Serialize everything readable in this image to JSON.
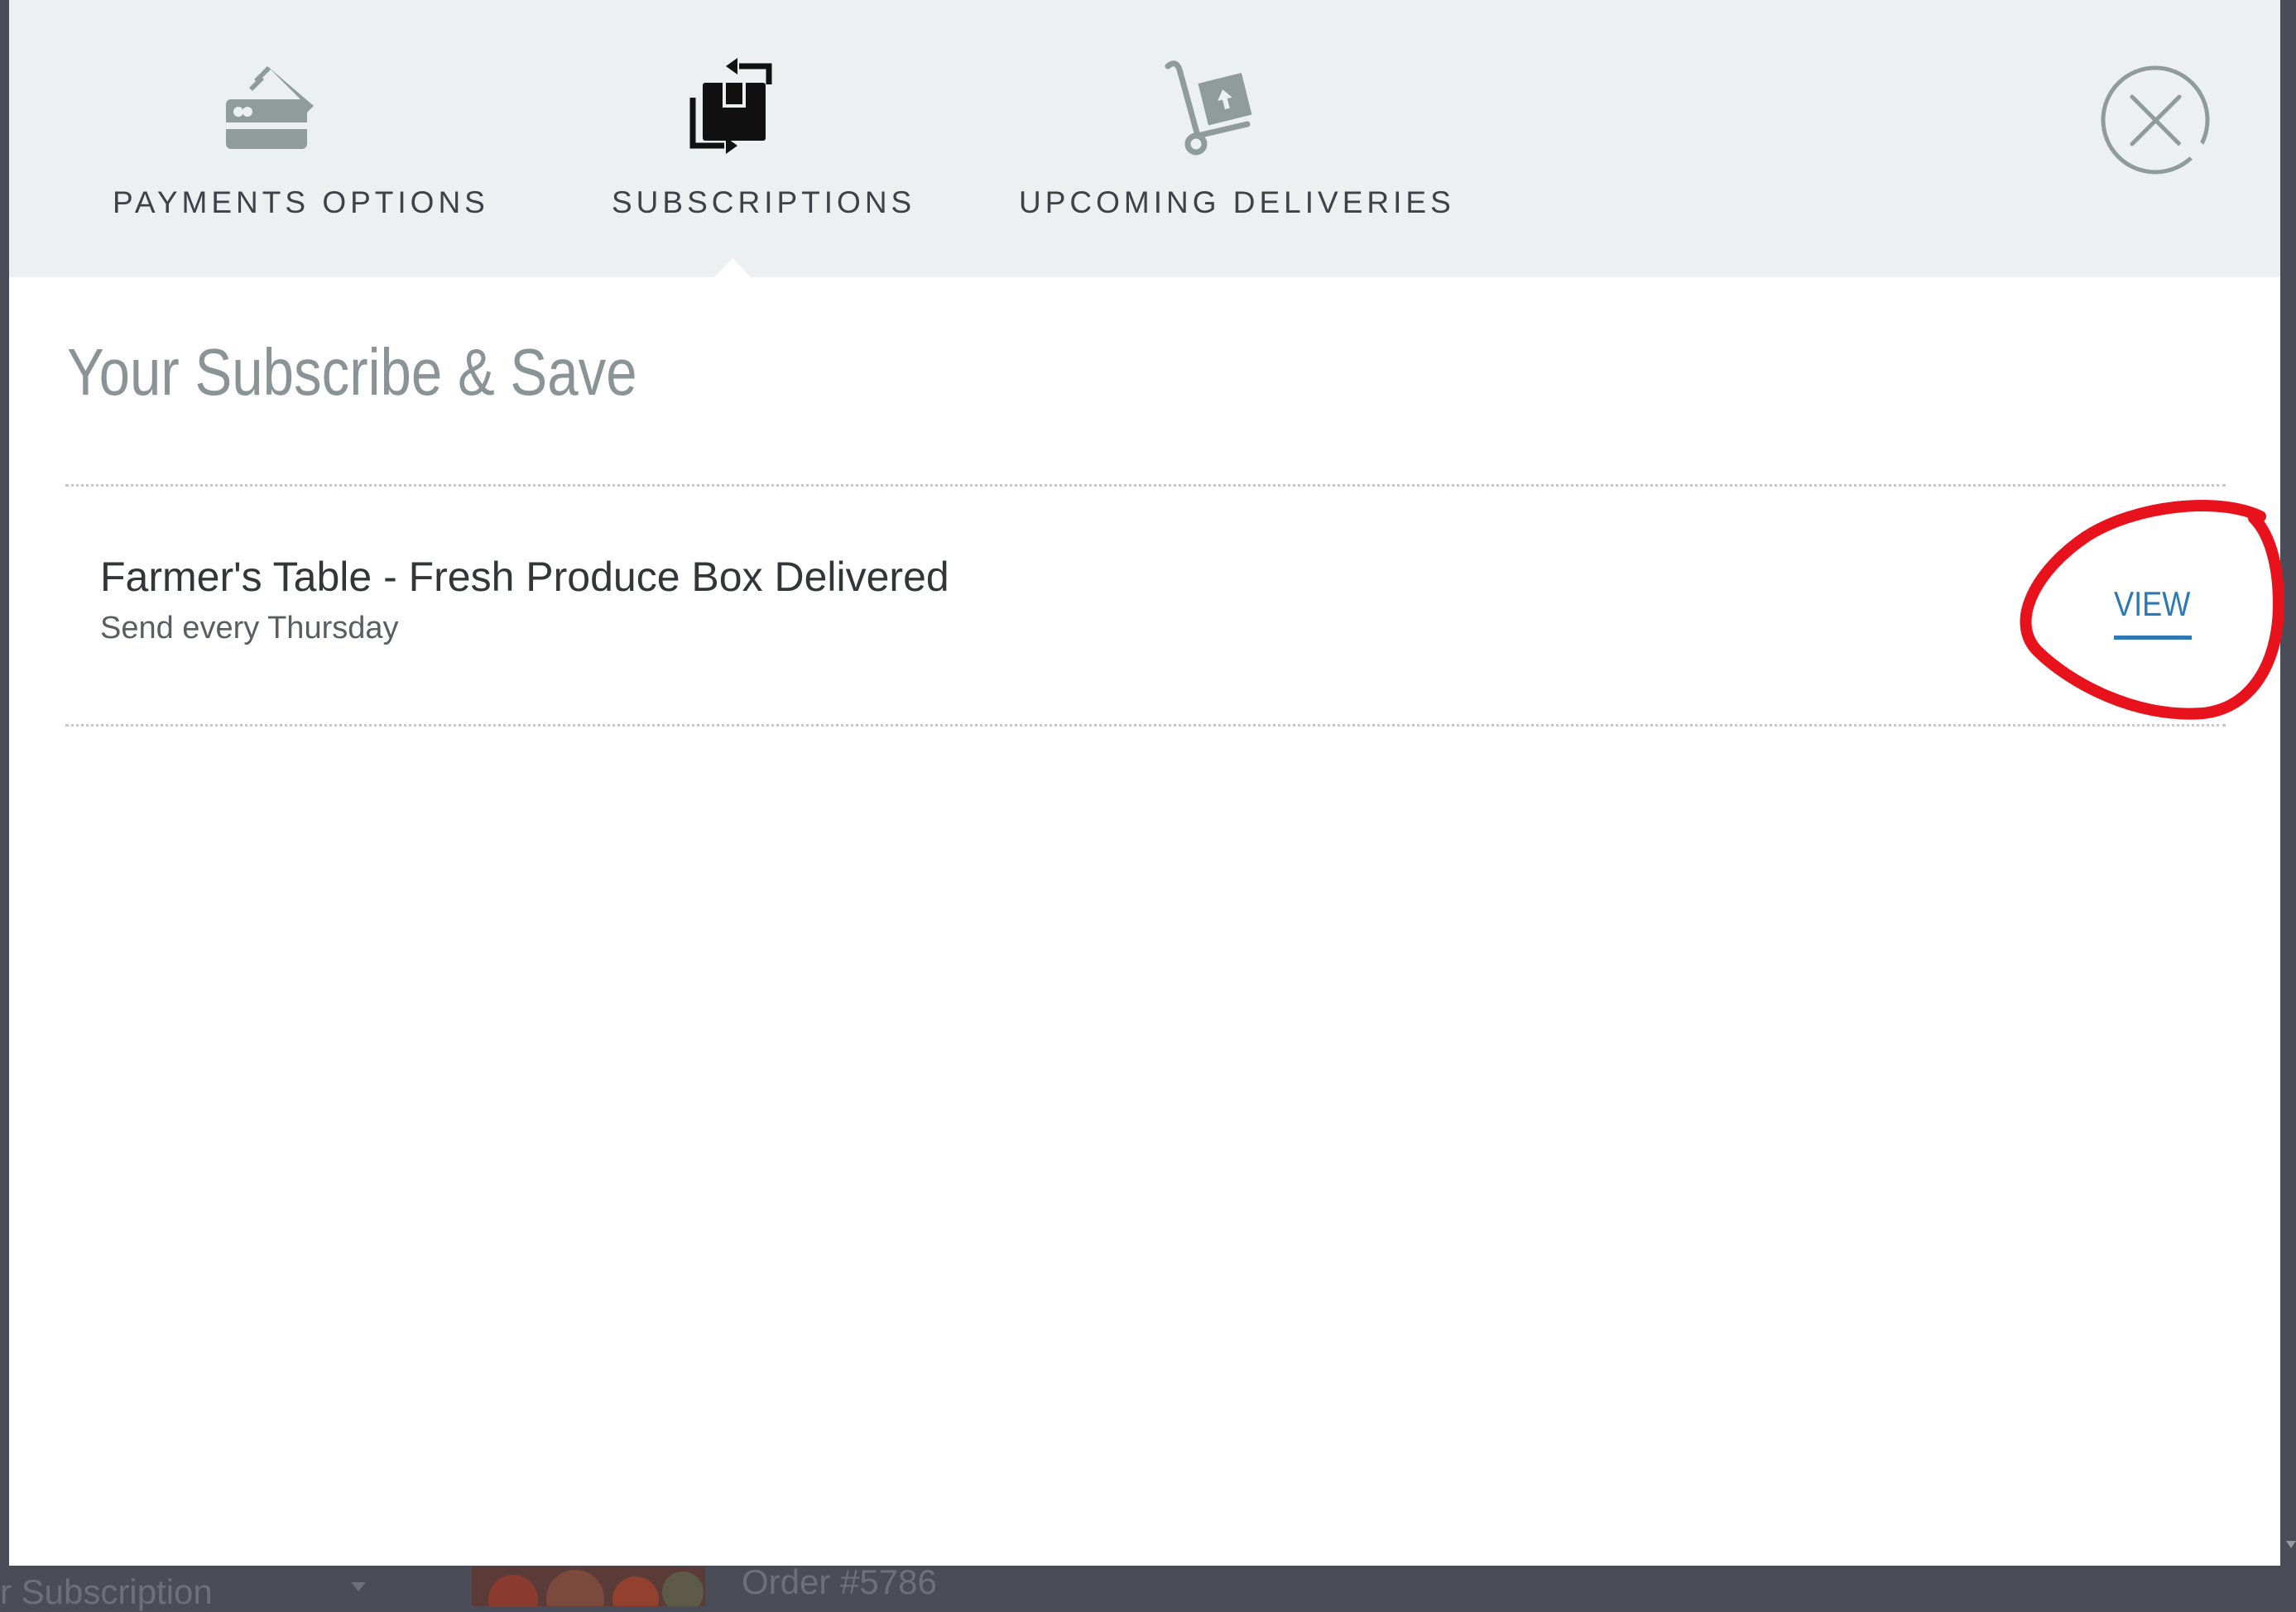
{
  "background": {
    "subscription_select_text": "r Subscription",
    "order_text": "Order #5786"
  },
  "tabs": [
    {
      "label": "PAYMENTS OPTIONS",
      "icon": "credit-card-icon",
      "active": false
    },
    {
      "label": "SUBSCRIPTIONS",
      "icon": "subscription-box-icon",
      "active": true
    },
    {
      "label": "UPCOMING DELIVERIES",
      "icon": "hand-truck-icon",
      "active": false
    }
  ],
  "close": {
    "icon": "close-circle-icon"
  },
  "main": {
    "title": "Your Subscribe & Save",
    "subscriptions": [
      {
        "name": "Farmer's Table - Fresh Produce Box Delivered",
        "schedule": "Send every Thursday",
        "action_label": "VIEW"
      }
    ]
  },
  "colors": {
    "tab_bar_bg": "#ecf0f1",
    "icon_inactive": "#8f9c99",
    "icon_active": "#111111",
    "link": "#2f79b3",
    "annotation": "#e8121c",
    "backdrop": "#4a4c57"
  }
}
